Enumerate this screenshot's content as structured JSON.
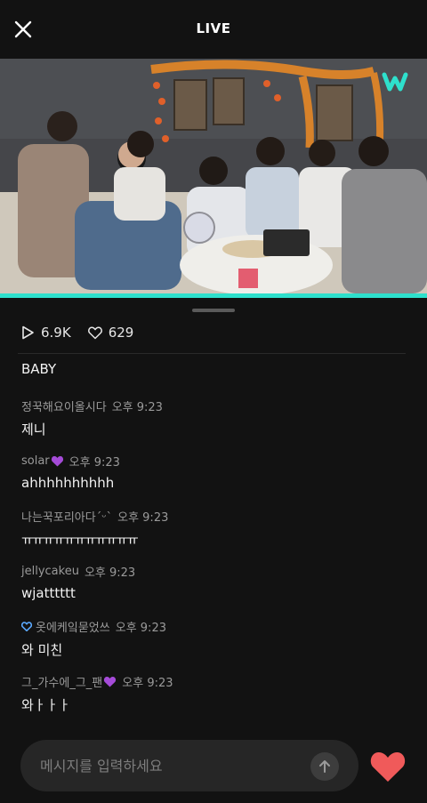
{
  "header": {
    "title": "LIVE"
  },
  "video": {
    "brand": "w"
  },
  "stats": {
    "plays": "6.9K",
    "likes": "629"
  },
  "chat": {
    "first_text": "BABY",
    "messages": [
      {
        "user": "정꾹해요이올시다",
        "time": "오후 9:23",
        "text": "제니"
      },
      {
        "user": "solar",
        "time": "오후 9:23",
        "text": "ahhhhhhhhhh"
      },
      {
        "user": "나는꾹포리아다´ᵕ`",
        "time": "오후 9:23",
        "text": "ㅠㅠㅠㅠㅠㅠㅠㅠㅠㅠㅠ"
      },
      {
        "user": "jellycakeu",
        "time": "오후 9:23",
        "text": "wjatttttt"
      },
      {
        "user": "옷에케잌묻었쓰",
        "time": "오후 9:23",
        "text": "와 미친"
      },
      {
        "user": "그_가수에_그_팬",
        "time": "오후 9:23",
        "text": "와ㅏㅏㅏ"
      }
    ]
  },
  "input": {
    "placeholder": "메시지를 입력하세요"
  },
  "colors": {
    "accent": "#2ee0cc",
    "like": "#f05a5a",
    "purple": "#a54bd8"
  }
}
